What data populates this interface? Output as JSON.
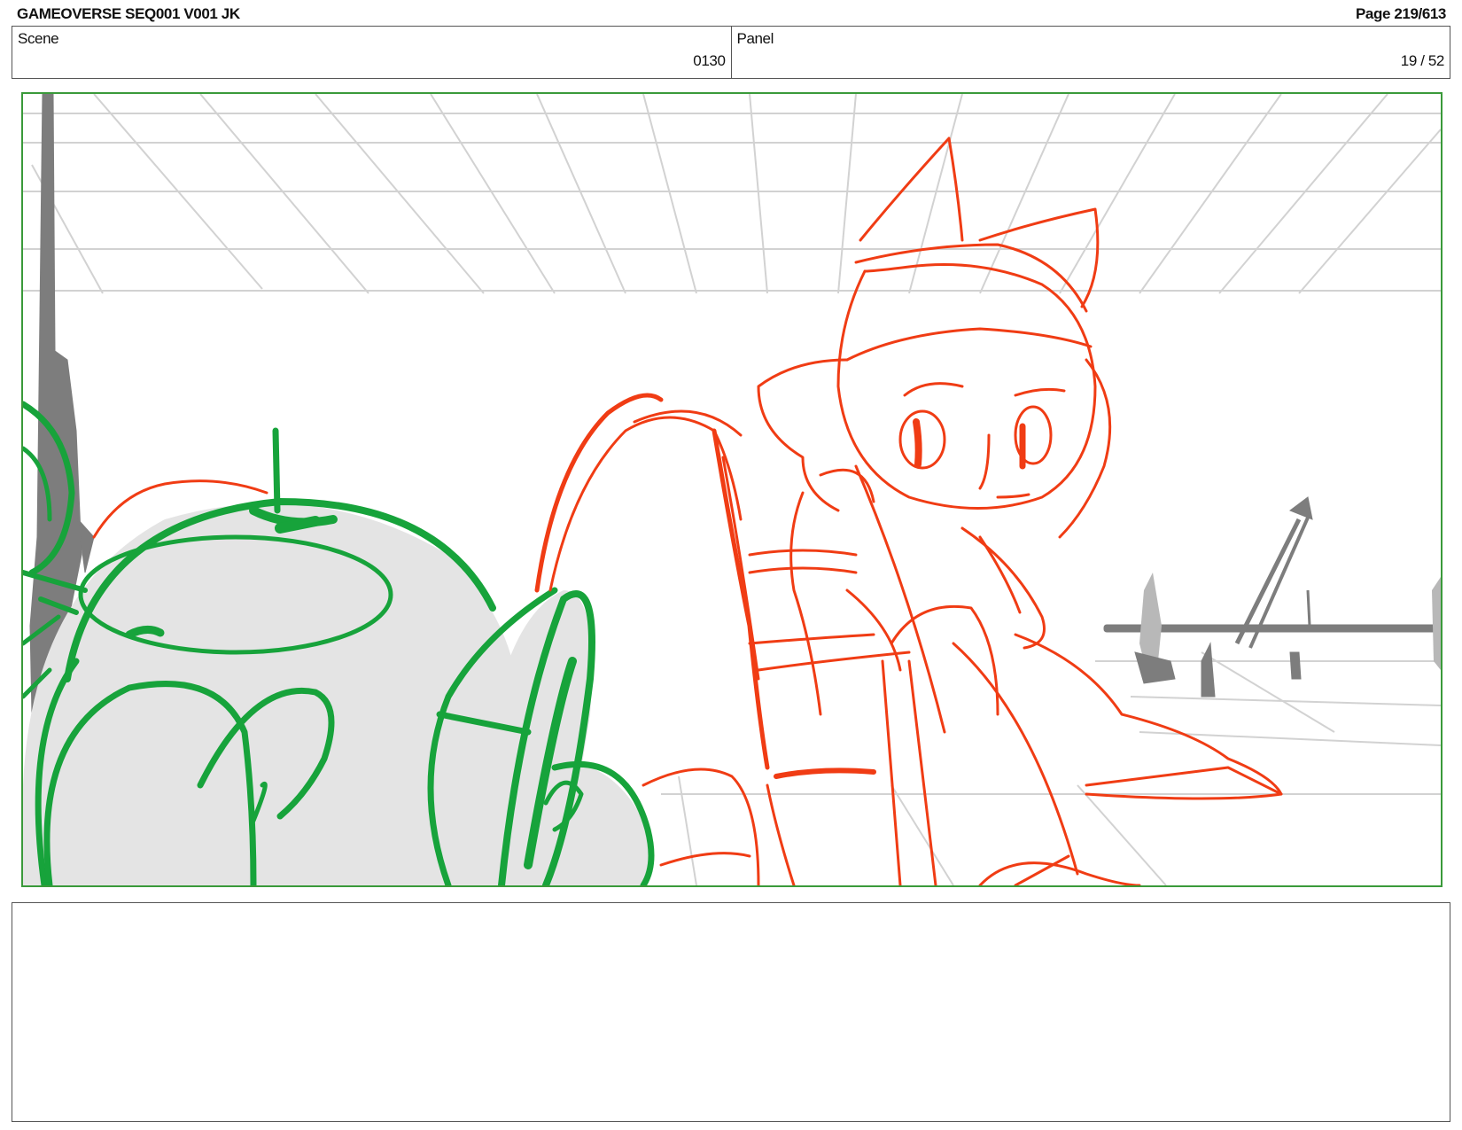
{
  "header": {
    "document_title": "GAMEOVERSE SEQ001 V001 JK",
    "page_indicator": "Page 219/613"
  },
  "info": {
    "scene_label": "Scene",
    "scene_value": "0130",
    "panel_label": "Panel",
    "panel_value": "19 / 52"
  },
  "artwork": {
    "description_colors": {
      "frame_border": "#3a9a3a",
      "robot_lines": "#16a33a",
      "robot_fill": "#e4e4e4",
      "character_lines": "#f03a12",
      "background_lines": "#cfcfcf",
      "props": "#7a7a7a"
    }
  },
  "notes": {
    "text": ""
  }
}
